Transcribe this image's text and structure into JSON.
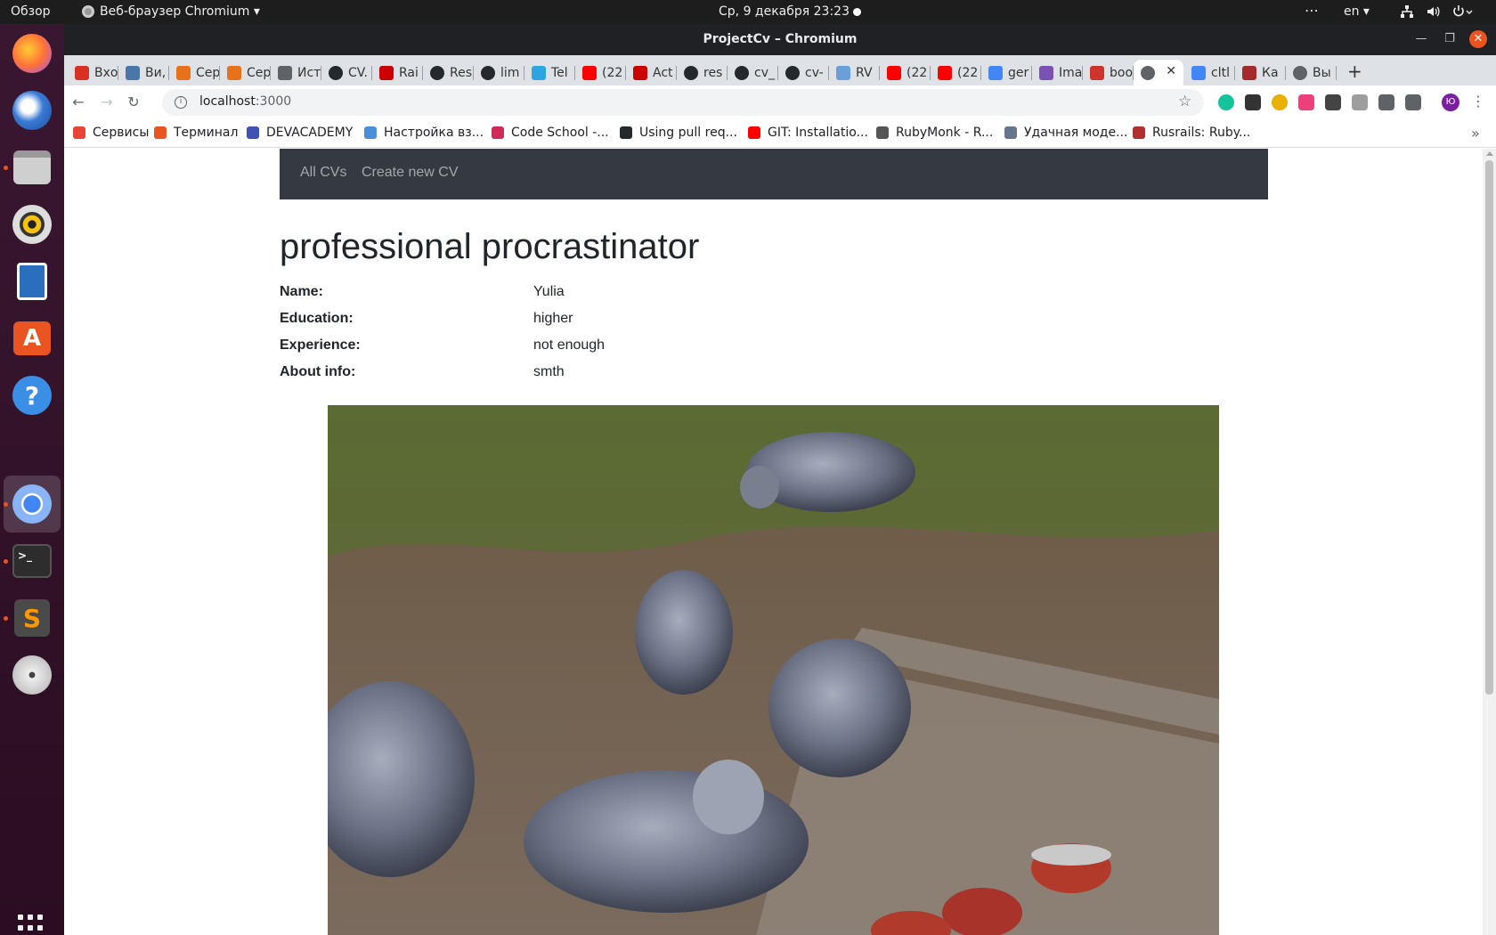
{
  "topbar": {
    "activities": "Обзор",
    "app_menu": "Веб-браузер Chromium ▾",
    "clock": "Ср, 9 декабря  23:23",
    "lang": "en ▾"
  },
  "window": {
    "title": "ProjectCv – Chromium"
  },
  "tabs": [
    {
      "label": "Вхо",
      "icon": "gmail-icon",
      "color": "#d93025"
    },
    {
      "label": "Ви,",
      "icon": "vk-icon",
      "color": "#4a76a8"
    },
    {
      "label": "Сер",
      "icon": "s-icon",
      "color": "#e8711c"
    },
    {
      "label": "Сер",
      "icon": "s-icon",
      "color": "#e8711c"
    },
    {
      "label": "Ист",
      "icon": "history-icon",
      "color": "#5f6368"
    },
    {
      "label": "CV.",
      "icon": "github-icon",
      "color": "#24292e"
    },
    {
      "label": "Rai",
      "icon": "rails-icon",
      "color": "#cc0000"
    },
    {
      "label": "Res",
      "icon": "github-icon",
      "color": "#24292e"
    },
    {
      "label": "lim",
      "icon": "github-icon",
      "color": "#24292e"
    },
    {
      "label": "Tel",
      "icon": "telegram-icon",
      "color": "#2ca5e0"
    },
    {
      "label": "(22",
      "icon": "youtube-icon",
      "color": "#ff0000"
    },
    {
      "label": "Act",
      "icon": "rails-icon",
      "color": "#cc0000"
    },
    {
      "label": "res",
      "icon": "github-icon",
      "color": "#24292e"
    },
    {
      "label": "cv_",
      "icon": "github-icon",
      "color": "#24292e"
    },
    {
      "label": "cv-",
      "icon": "github-icon",
      "color": "#24292e"
    },
    {
      "label": "RV",
      "icon": "rubyvideo-icon",
      "color": "#6aa0d8"
    },
    {
      "label": "(22",
      "icon": "youtube-icon",
      "color": "#ff0000"
    },
    {
      "label": "(22",
      "icon": "youtube-icon",
      "color": "#ff0000"
    },
    {
      "label": "ger",
      "icon": "google-icon",
      "color": "#4285f4"
    },
    {
      "label": "Ima",
      "icon": "bootstrap-icon",
      "color": "#7952b3"
    },
    {
      "label": "boo",
      "icon": "ruby-icon",
      "color": "#cc342d"
    },
    {
      "label": "",
      "icon": "globe-icon",
      "color": "#5f6368",
      "active": true
    },
    {
      "label": "cltl",
      "icon": "google-icon",
      "color": "#4285f4"
    },
    {
      "label": "Ка",
      "icon": "cube-icon",
      "color": "#a52a2a"
    },
    {
      "label": "Вы",
      "icon": "globe-icon",
      "color": "#5f6368"
    }
  ],
  "address": {
    "host": "localhost",
    "path": ":3000"
  },
  "bookmarks": [
    {
      "label": "Сервисы",
      "icon": "apps-grid-icon",
      "color": "#ea4335"
    },
    {
      "label": "Терминал",
      "icon": "ubuntu-icon",
      "color": "#e95420"
    },
    {
      "label": "DEVACADEMY",
      "icon": "graduation-cap-icon",
      "color": "#3f51b5"
    },
    {
      "label": "Настройка вз...",
      "icon": "settings-page-icon",
      "color": "#4a90d9"
    },
    {
      "label": "Code School -...",
      "icon": "codeschool-icon",
      "color": "#d12a5a"
    },
    {
      "label": "Using pull req...",
      "icon": "github-icon",
      "color": "#24292e"
    },
    {
      "label": "GIT: Installatio...",
      "icon": "youtube-icon",
      "color": "#ff0000"
    },
    {
      "label": "RubyMonk - R...",
      "icon": "rubymonk-icon",
      "color": "#555555"
    },
    {
      "label": "Удачная моде...",
      "icon": "habr-icon",
      "color": "#65758b"
    },
    {
      "label": "Rusrails: Ruby...",
      "icon": "rusrails-icon",
      "color": "#b03030"
    }
  ],
  "page": {
    "nav": {
      "all_cvs": "All CVs",
      "create": "Create new CV"
    },
    "title": "professional procrastinator",
    "fields": [
      {
        "label": "Name:",
        "value": "Yulia"
      },
      {
        "label": "Education:",
        "value": "higher"
      },
      {
        "label": "Experience:",
        "value": "not enough"
      },
      {
        "label": "About info:",
        "value": "smth"
      }
    ]
  },
  "colors": {
    "navbar_bg": "#343a40",
    "ubuntu_orange": "#e95420"
  }
}
